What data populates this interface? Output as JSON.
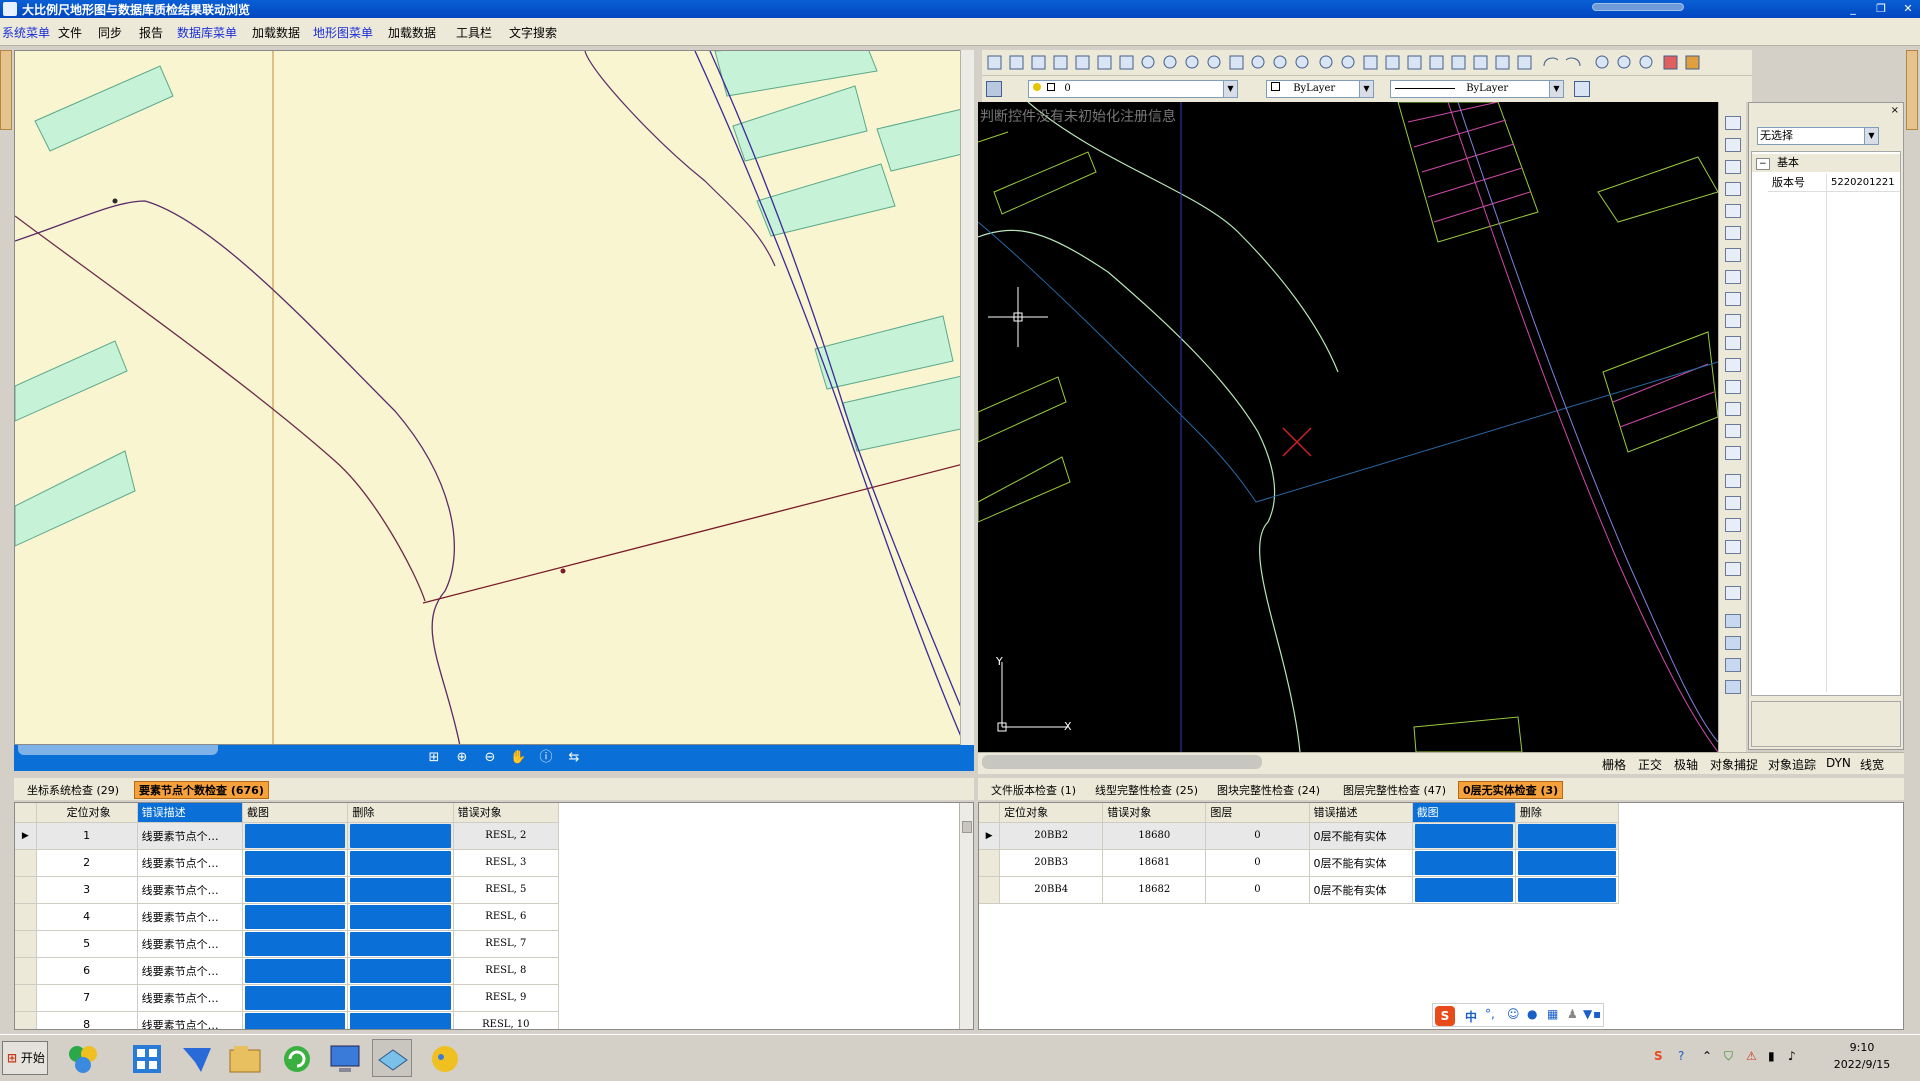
{
  "window": {
    "title": "大比例尺地形图与数据库质检结果联动浏览",
    "controls": [
      "_",
      "❐",
      "✕"
    ]
  },
  "menu": [
    {
      "label": "系统菜单",
      "accent": true
    },
    {
      "label": "文件",
      "accent": false
    },
    {
      "label": "同步",
      "accent": false
    },
    {
      "label": "报告",
      "accent": false
    },
    {
      "label": "数据库菜单",
      "accent": true
    },
    {
      "label": "加载数据",
      "accent": false
    },
    {
      "label": "地形图菜单",
      "accent": true
    },
    {
      "label": "加载数据",
      "accent": false
    },
    {
      "label": "工具栏",
      "accent": false
    },
    {
      "label": "文字搜索",
      "accent": false
    }
  ],
  "left_map": {
    "background_color": "#f8f5d0",
    "polygon_color": "#c6f2d8",
    "toolbar_icons": [
      "zoom-extent-icon",
      "zoom-in-icon",
      "zoom-out-icon",
      "pan-hand-icon",
      "identify-info-icon",
      "measure-icon"
    ]
  },
  "cad": {
    "layer_value": "0",
    "color_value": "ByLayer",
    "linetype_value": "ByLayer",
    "watermark": "判断控件没有未初始化注册信息",
    "axis_x": "X",
    "axis_y": "Y",
    "status_items": [
      "栅格",
      "正交",
      "极轴",
      "对象捕捉",
      "对象追踪",
      "DYN",
      "线宽"
    ]
  },
  "properties": {
    "selection": "无选择",
    "group": "基本",
    "rows": [
      {
        "key": "版本号",
        "value": "5220201221"
      }
    ]
  },
  "left_tabs": [
    {
      "label": "坐标系统检查 (29)",
      "active": false
    },
    {
      "label": "要素节点个数检查 (676)",
      "active": true
    }
  ],
  "right_tabs": [
    {
      "label": "文件版本检查 (1)",
      "active": false
    },
    {
      "label": "线型完整性检查 (25)",
      "active": false
    },
    {
      "label": "图块完整性检查 (24)",
      "active": false
    },
    {
      "label": "图层完整性检查 (47)",
      "active": false
    },
    {
      "label": "0层无实体检查 (3)",
      "active": true
    }
  ],
  "left_grid": {
    "columns": [
      "定位对象",
      "错误描述",
      "截图",
      "删除",
      "错误对象"
    ],
    "highlight_column": "错误描述",
    "rows": [
      {
        "id": "1",
        "desc": "线要素节点个…",
        "obj": "RESL, 2"
      },
      {
        "id": "2",
        "desc": "线要素节点个…",
        "obj": "RESL, 3"
      },
      {
        "id": "3",
        "desc": "线要素节点个…",
        "obj": "RESL, 5"
      },
      {
        "id": "4",
        "desc": "线要素节点个…",
        "obj": "RESL, 6"
      },
      {
        "id": "5",
        "desc": "线要素节点个…",
        "obj": "RESL, 7"
      },
      {
        "id": "6",
        "desc": "线要素节点个…",
        "obj": "RESL, 8"
      },
      {
        "id": "7",
        "desc": "线要素节点个…",
        "obj": "RESL, 9"
      },
      {
        "id": "8",
        "desc": "线要素节点个…",
        "obj": "RESL, 10"
      }
    ]
  },
  "right_grid": {
    "columns": [
      "定位对象",
      "错误对象",
      "图层",
      "错误描述",
      "截图",
      "删除"
    ],
    "highlight_column": "截图",
    "rows": [
      {
        "locate": "20BB2",
        "obj": "18680",
        "layer": "0",
        "desc": "0层不能有实体"
      },
      {
        "locate": "20BB3",
        "obj": "18681",
        "layer": "0",
        "desc": "0层不能有实体"
      },
      {
        "locate": "20BB4",
        "obj": "18682",
        "layer": "0",
        "desc": "0层不能有实体"
      }
    ]
  },
  "ime_toolbar": {
    "label": "中",
    "icons": [
      "sogou-s-icon",
      "punctuation-icon",
      "emoji-icon",
      "mic-icon",
      "keyboard-icon",
      "user-icon",
      "shirt-icon",
      "grid-icon"
    ]
  },
  "taskbar": {
    "start_label": "开始",
    "apps": [
      "360-security-icon",
      "app-grid-icon",
      "feiq-bird-icon",
      "file-explorer-icon",
      "refresh-green-icon",
      "computer-icon",
      "map-browser-icon",
      "qq-chat-icon"
    ],
    "time": "9:10",
    "date": "2022/9/15"
  },
  "colors": {
    "accent_blue": "#0a6fd6",
    "active_tab": "#f7a13a",
    "cad_bg": "#000000"
  }
}
